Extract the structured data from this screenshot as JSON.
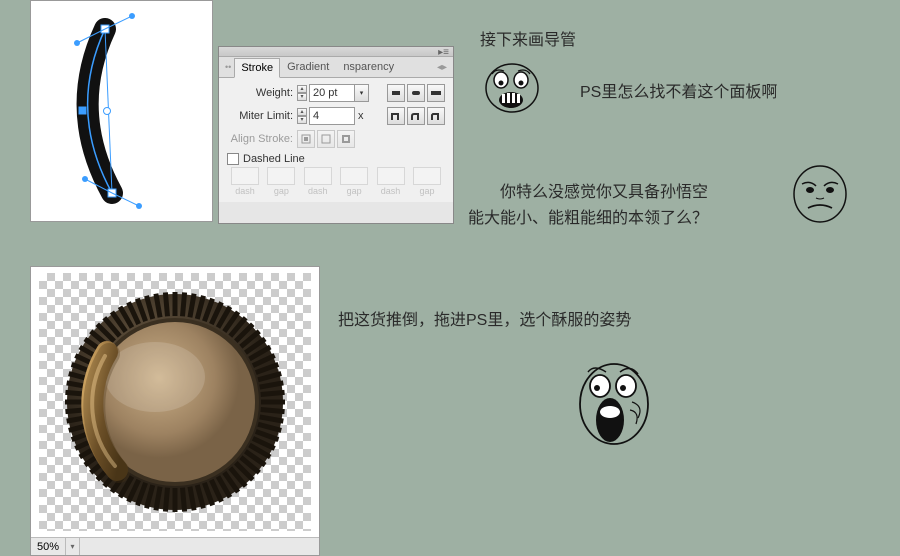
{
  "annotations": {
    "t1": "接下来画导管",
    "t2": "PS里怎么找不着这个面板啊",
    "t3": "你特么没感觉你又具备孙悟空",
    "t4": "能大能小、能粗能细的本领了么？",
    "t5": "把这货推倒，拖进PS里，选个酥服的姿势"
  },
  "panel": {
    "tabs": {
      "stroke": "Stroke",
      "gradient": "Gradient",
      "transparency": "nsparency"
    },
    "weight_label": "Weight:",
    "weight_value": "20 pt",
    "miter_label": "Miter Limit:",
    "miter_value": "4",
    "miter_unit": "x",
    "align_label": "Align Stroke:",
    "dashed_label": "Dashed Line",
    "dash_cells": [
      "dash",
      "gap",
      "dash",
      "gap",
      "dash",
      "gap"
    ]
  },
  "zoom": {
    "value": "50%"
  }
}
